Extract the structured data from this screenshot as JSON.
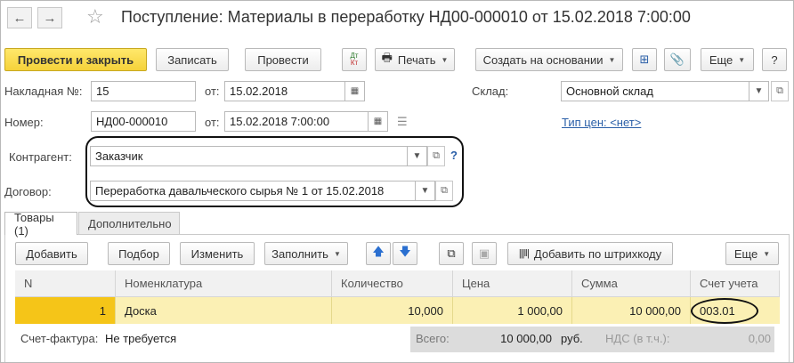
{
  "window": {
    "title": "Поступление: Материалы в переработку НД00-000010 от 15.02.2018 7:00:00",
    "back_icon": "←",
    "forward_icon": "→",
    "star_icon": "☆"
  },
  "toolbar": {
    "post_close": "Провести и закрыть",
    "save": "Записать",
    "post": "Провести",
    "dtkt_dt": "Дт",
    "dtkt_kt": "Кт",
    "print": "Печать",
    "create_based": "Создать на основании",
    "more": "Еще",
    "help": "?"
  },
  "header": {
    "invoice_label": "Накладная №:",
    "invoice_number": "15",
    "from_label": "от:",
    "invoice_date": "15.02.2018",
    "warehouse_label": "Склад:",
    "warehouse": "Основной склад",
    "number_label": "Номер:",
    "number": "НД00-000010",
    "from_label2": "от:",
    "doc_datetime": "15.02.2018  7:00:00",
    "price_type_link": "Тип цен: <нет>",
    "counterparty_label": "Контрагент:",
    "counterparty": "Заказчик",
    "contract_label": "Договор:",
    "contract": "Переработка давальческого сырья № 1 от 15.02.2018"
  },
  "tabs": [
    {
      "label": "Товары (1)"
    },
    {
      "label": "Дополнительно"
    }
  ],
  "table_toolbar": {
    "add": "Добавить",
    "select": "Подбор",
    "edit": "Изменить",
    "fill": "Заполнить",
    "add_barcode": "Добавить по штрихкоду",
    "more": "Еще"
  },
  "table": {
    "columns": [
      "N",
      "Номенклатура",
      "Количество",
      "Цена",
      "Сумма",
      "Счет учета"
    ],
    "rows": [
      {
        "n": "1",
        "item": "Доска",
        "qty": "10,000",
        "price": "1 000,00",
        "sum": "10 000,00",
        "account": "003.01"
      }
    ]
  },
  "footer": {
    "invoice_label": "Счет-фактура:",
    "invoice_value": "Не требуется",
    "total_label": "Всего:",
    "total_value": "10 000,00",
    "currency": "руб.",
    "vat_label": "НДС (в т.ч.):",
    "vat_value": "0,00"
  }
}
